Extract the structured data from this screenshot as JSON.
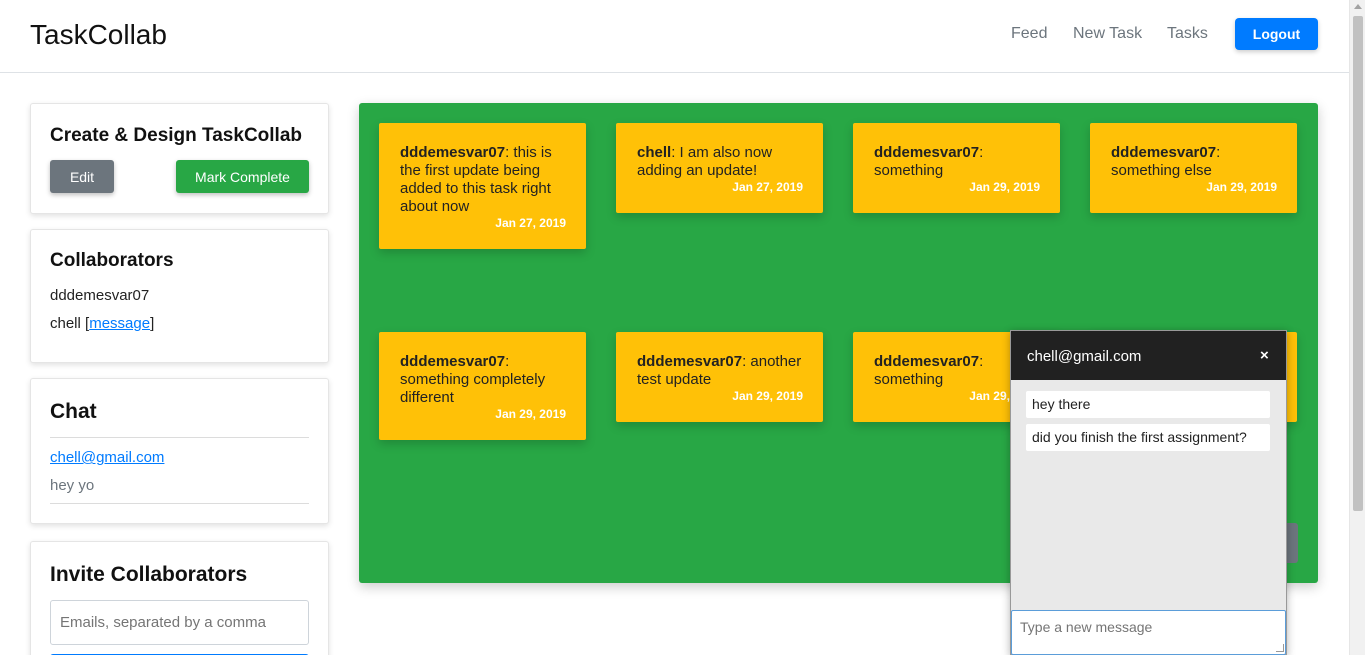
{
  "header": {
    "brand": "TaskCollab",
    "nav": [
      "Feed",
      "New Task",
      "Tasks"
    ],
    "logout_label": "Logout"
  },
  "task_card": {
    "title": "Create & Design TaskCollab",
    "edit_label": "Edit",
    "complete_label": "Mark Complete"
  },
  "collaborators": {
    "title": "Collaborators",
    "users": [
      {
        "name": "dddemesvar07"
      },
      {
        "name": "chell ",
        "link": "message"
      }
    ],
    "bracket_open": "[",
    "bracket_close": "]"
  },
  "chat_card": {
    "title": "Chat",
    "conversations": [
      {
        "email": "chell@gmail.com",
        "preview": "hey yo"
      }
    ]
  },
  "invite": {
    "title": "Invite Collaborators",
    "placeholder": "Emails, separated by a comma"
  },
  "updates": [
    {
      "user": "dddemesvar07",
      "text": ": this is the first update being added to this task right about now",
      "date": "Jan 27, 2019"
    },
    {
      "user": "chell",
      "text": ": I am also now adding an update!",
      "date": "Jan 27, 2019"
    },
    {
      "user": "dddemesvar07",
      "text": ": something",
      "date": "Jan 29, 2019"
    },
    {
      "user": "dddemesvar07",
      "text": ": something else",
      "date": "Jan 29, 2019"
    },
    {
      "user": "dddemesvar07",
      "text": ": something completely different",
      "date": "Jan 29, 2019"
    },
    {
      "user": "dddemesvar07",
      "text": ": another test update",
      "date": "Jan 29, 2019"
    },
    {
      "user": "dddemesvar07",
      "text": ": something",
      "date": "Jan 29, 2019"
    }
  ],
  "chat_popup": {
    "title": "chell@gmail.com",
    "close": "×",
    "messages": [
      "hey there",
      "did you finish the first assignment?"
    ],
    "input_placeholder": "Type a new message"
  },
  "colors": {
    "primary": "#007bff",
    "success": "#28a745",
    "warning": "#ffc107",
    "secondary": "#6c757d",
    "dark": "#212121"
  }
}
